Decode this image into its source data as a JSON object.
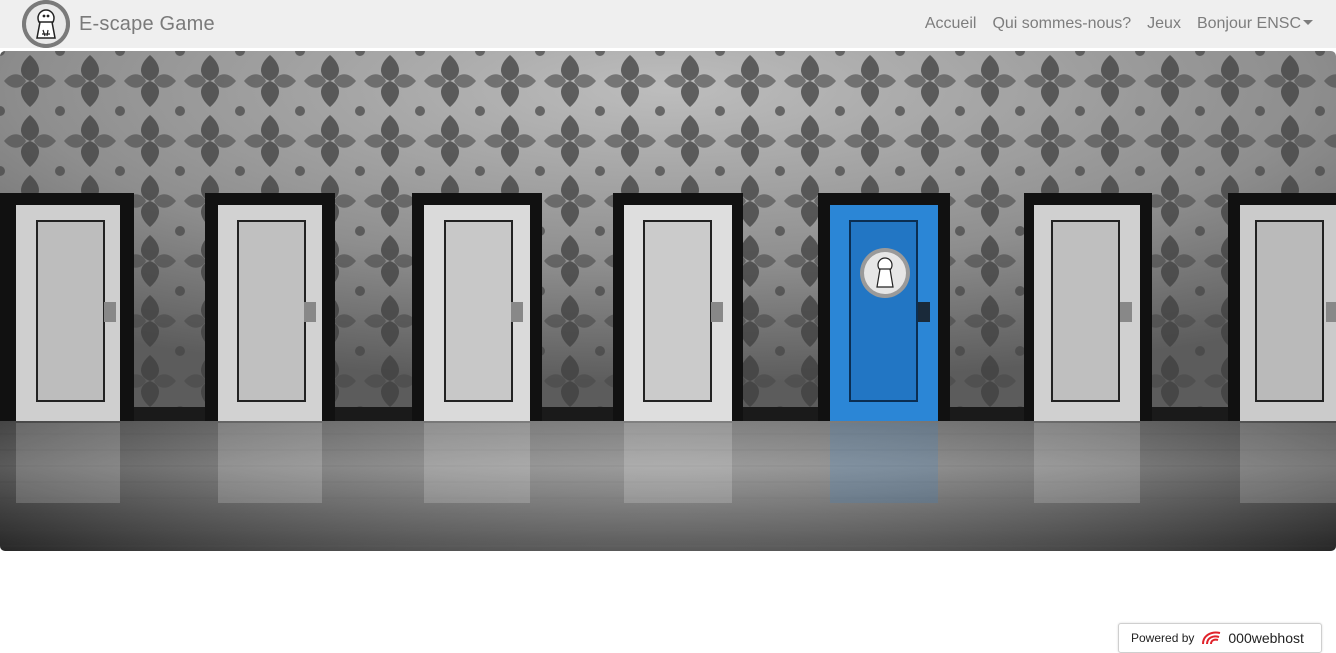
{
  "navbar": {
    "brand": "E-scape Game",
    "logo_icon": "keyhole-logo-icon",
    "links": [
      {
        "label": "Accueil"
      },
      {
        "label": "Qui sommes-nous?"
      },
      {
        "label": "Jeux"
      }
    ],
    "dropdown": {
      "label": "Bonjour ENSC",
      "icon": "caret-down-icon"
    }
  },
  "hero": {
    "image": "row-of-doors-hero-image",
    "highlight_color": "#2b86d6"
  },
  "footer_badge": {
    "powered_by": "Powered by",
    "host": "000webhost",
    "icon": "000webhost-swirl-icon"
  }
}
